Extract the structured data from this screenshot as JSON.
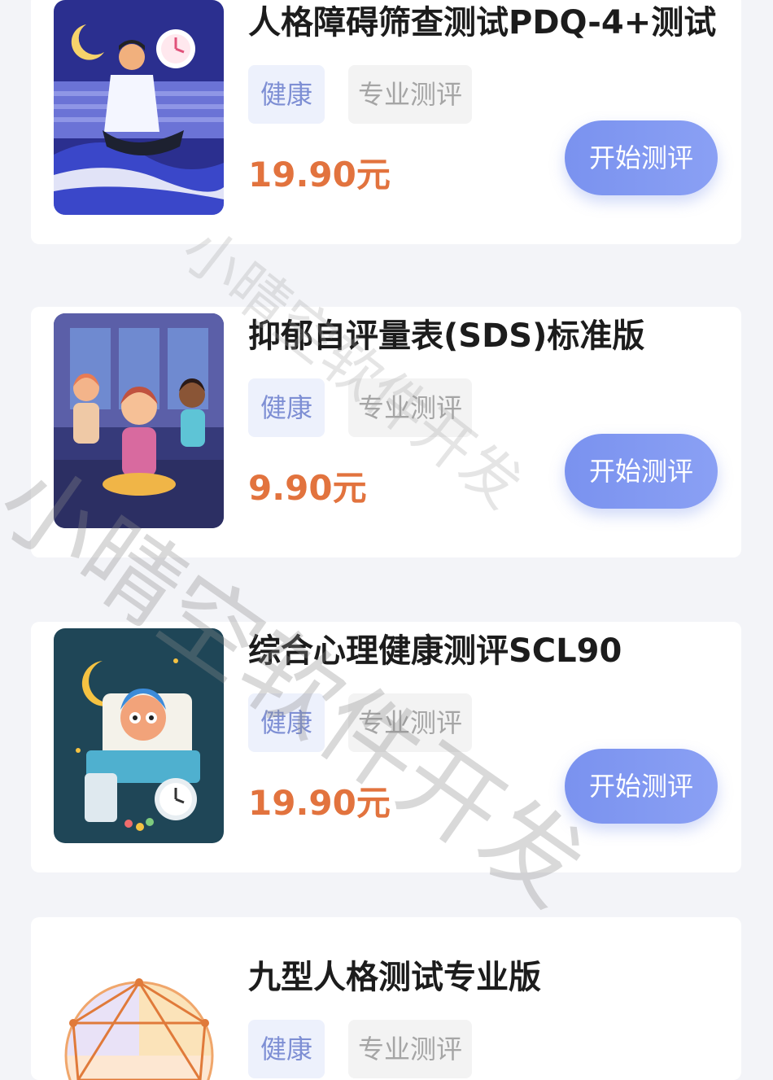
{
  "cards": [
    {
      "title": "人格障碍筛查测试PDQ-4+测试",
      "tag1": "健康",
      "tag2": "专业测评",
      "price": "19.90元",
      "button": "开始测评"
    },
    {
      "title": "抑郁自评量表(SDS)标准版",
      "tag1": "健康",
      "tag2": "专业测评",
      "price": "9.90元",
      "button": "开始测评"
    },
    {
      "title": "综合心理健康测评SCL90",
      "tag1": "健康",
      "tag2": "专业测评",
      "price": "19.90元",
      "button": "开始测评"
    },
    {
      "title": "九型人格测试专业版",
      "tag1": "健康",
      "tag2": "专业测评",
      "price": "",
      "button": ""
    }
  ],
  "watermark": {
    "text": "小晴空软件开发"
  },
  "colors": {
    "accent": "#7a92ef",
    "price": "#e2733e",
    "page_bg": "#f3f4f8"
  }
}
